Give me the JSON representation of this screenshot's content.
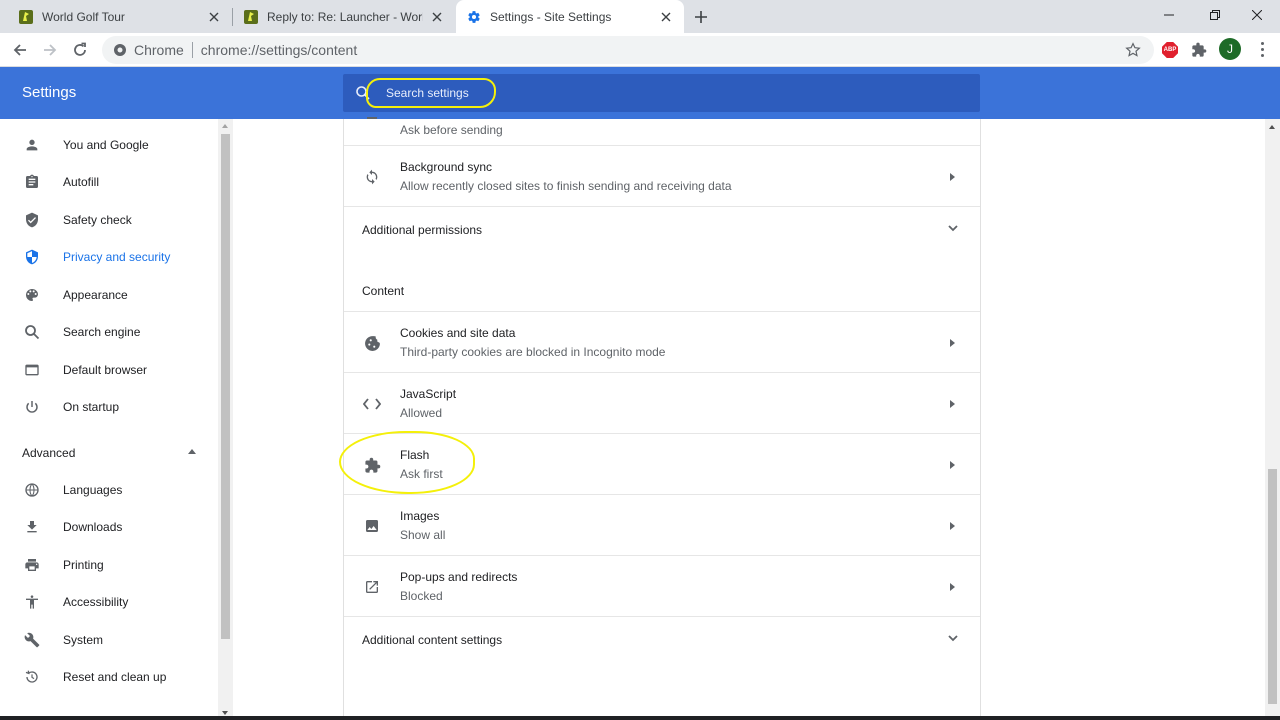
{
  "browser": {
    "tabs": [
      {
        "title": "World Golf Tour",
        "active": false
      },
      {
        "title": "Reply to: Re: Launcher - World Golf Tour",
        "active": false
      },
      {
        "title": "Settings - Site Settings",
        "active": true
      }
    ],
    "omnibox": {
      "chip": "Chrome",
      "url": "chrome://settings/content"
    },
    "extensions": {
      "abp_label": "ABP"
    },
    "avatar_letter": "J"
  },
  "settings": {
    "title": "Settings",
    "search_placeholder": "Search settings"
  },
  "sidebar": {
    "items": [
      {
        "label": "You and Google",
        "icon": "person-icon",
        "active": false
      },
      {
        "label": "Autofill",
        "icon": "clipboard-icon",
        "active": false
      },
      {
        "label": "Safety check",
        "icon": "shield-check-icon",
        "active": false
      },
      {
        "label": "Privacy and security",
        "icon": "shield-icon",
        "active": true
      },
      {
        "label": "Appearance",
        "icon": "palette-icon",
        "active": false
      },
      {
        "label": "Search engine",
        "icon": "search-icon",
        "active": false
      },
      {
        "label": "Default browser",
        "icon": "browser-icon",
        "active": false
      },
      {
        "label": "On startup",
        "icon": "power-icon",
        "active": false
      }
    ],
    "advanced_label": "Advanced",
    "advanced_items": [
      {
        "label": "Languages",
        "icon": "globe-icon"
      },
      {
        "label": "Downloads",
        "icon": "download-icon"
      },
      {
        "label": "Printing",
        "icon": "printer-icon"
      },
      {
        "label": "Accessibility",
        "icon": "accessibility-icon"
      },
      {
        "label": "System",
        "icon": "wrench-icon"
      },
      {
        "label": "Reset and clean up",
        "icon": "history-icon"
      }
    ]
  },
  "content": {
    "partial_row_sub": "Ask before sending",
    "background_sync": {
      "title": "Background sync",
      "sub": "Allow recently closed sites to finish sending and receiving data"
    },
    "additional_permissions": "Additional permissions",
    "content_label": "Content",
    "rows": [
      {
        "title": "Cookies and site data",
        "sub": "Third-party cookies are blocked in Incognito mode",
        "icon": "cookie-icon"
      },
      {
        "title": "JavaScript",
        "sub": "Allowed",
        "icon": "code-icon"
      },
      {
        "title": "Flash",
        "sub": "Ask first",
        "icon": "puzzle-icon"
      },
      {
        "title": "Images",
        "sub": "Show all",
        "icon": "image-icon"
      },
      {
        "title": "Pop-ups and redirects",
        "sub": "Blocked",
        "icon": "open-in-new-icon"
      }
    ],
    "additional_content_settings": "Additional content settings"
  },
  "colors": {
    "header": "#3b73d9",
    "accent": "#1a73e8",
    "highlight": "#f4f00a"
  }
}
